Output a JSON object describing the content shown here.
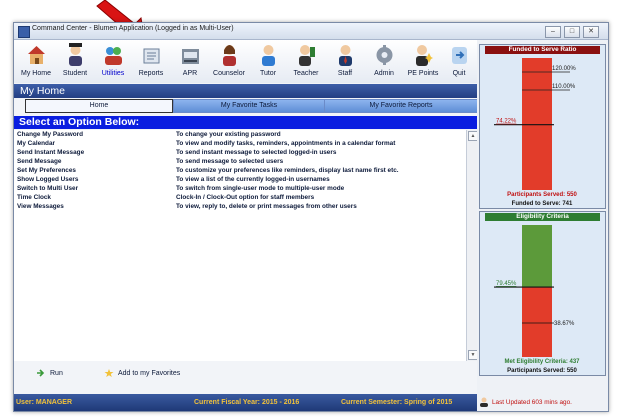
{
  "window": {
    "title": "Command Center - Blumen Application (Logged in as Multi-User)",
    "controls": {
      "minimize": "–",
      "maximize": "□",
      "close": "✕"
    }
  },
  "toolbar": {
    "items": [
      {
        "label": "My Home",
        "icon": "house-icon",
        "active": false
      },
      {
        "label": "Student",
        "icon": "student-icon",
        "active": false
      },
      {
        "label": "Utilities",
        "icon": "utilities-icon",
        "active": true
      },
      {
        "label": "Reports",
        "icon": "reports-icon",
        "active": false
      },
      {
        "label": "APR",
        "icon": "apr-icon",
        "active": false
      },
      {
        "label": "Counselor",
        "icon": "counselor-icon",
        "active": false
      },
      {
        "label": "Tutor",
        "icon": "tutor-icon",
        "active": false
      },
      {
        "label": "Teacher",
        "icon": "teacher-icon",
        "active": false
      },
      {
        "label": "Staff",
        "icon": "staff-icon",
        "active": false
      },
      {
        "label": "Admin",
        "icon": "admin-gear-icon",
        "active": false
      },
      {
        "label": "PE Points",
        "icon": "pe-points-icon",
        "active": false
      },
      {
        "label": "Quit",
        "icon": "quit-icon",
        "active": false
      }
    ]
  },
  "page": {
    "title": "My Home"
  },
  "tabs": [
    {
      "label": "Home",
      "active": true
    },
    {
      "label": "My Favorite Tasks",
      "active": false
    },
    {
      "label": "My Favorite Reports",
      "active": false
    }
  ],
  "options": {
    "heading": "Select an Option Below:",
    "rows": [
      {
        "name": "Change My Password",
        "desc": "To change your existing password"
      },
      {
        "name": "My Calendar",
        "desc": "To view and modify tasks, reminders, appointments in a calendar format"
      },
      {
        "name": "Send Instant Message",
        "desc": "To send instant message to selected logged-in users"
      },
      {
        "name": "Send Message",
        "desc": "To send message to selected users"
      },
      {
        "name": "Set My Preferences",
        "desc": "To customize your preferences like reminders, display last name first etc."
      },
      {
        "name": "Show Logged Users",
        "desc": "To view a list of the currently logged-in usernames"
      },
      {
        "name": "Switch to Multi User",
        "desc": "To switch from single-user mode to multiple-user mode"
      },
      {
        "name": "Time Clock",
        "desc": "Clock-In / Clock-Out option for staff members"
      },
      {
        "name": "View Messages",
        "desc": "To view, reply to, delete or print messages from other users"
      }
    ]
  },
  "actions": {
    "run": "Run",
    "add_favorites": "Add to my Favorites"
  },
  "status": {
    "user": "User: MANAGER",
    "fiscal_year": "Current Fiscal Year: 2015 - 2016",
    "semester": "Current Semester: Spring of 2015",
    "last_updated": "Last Updated 603 mins ago."
  },
  "funded_panel": {
    "title": "Funded to Serve Ratio",
    "target_label_high": "120.00%",
    "target_label_mid": "110.00%",
    "current_label": "74.22%",
    "current_fraction": 0.7422,
    "participants": "Participants Served: 550",
    "funded": "Funded to Serve: 741"
  },
  "eligibility_panel": {
    "title": "Eligibility Criteria",
    "top_label": "79.45%",
    "bottom_label": "38.67%",
    "top_fraction": 0.7945,
    "bottom_fraction": 0.3867,
    "met": "Met Eligibility Criteria: 437",
    "participants": "Participants Served: 550"
  },
  "colors": {
    "title_bar_blue": "#2c4a8e",
    "option_bar_blue": "#0a1ee0",
    "gauge_green": "#5c9a3a",
    "gauge_red": "#e23c2a",
    "status_yellow": "#f2c23a",
    "panel_title_red": "#8a1010",
    "panel_title_green": "#2e7d32"
  }
}
